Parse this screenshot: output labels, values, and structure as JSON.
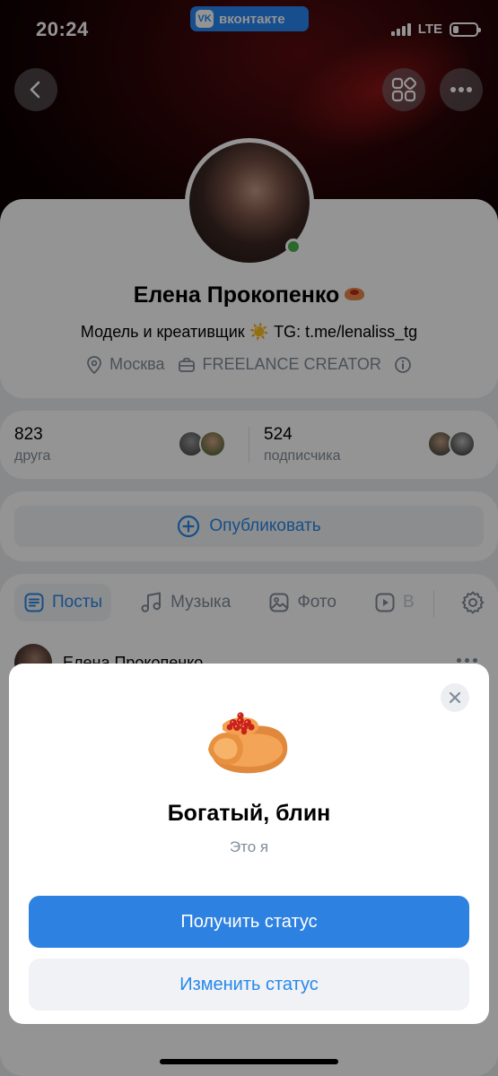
{
  "status_bar": {
    "time": "20:24",
    "app_badge": "вконтакте",
    "network": "LTE",
    "battery_level": 0.25
  },
  "header": {
    "back_icon": "chevron-left-icon",
    "services_icon": "grid-icon",
    "more_icon": "ellipsis-icon"
  },
  "profile": {
    "name": "Елена Прокопенко",
    "bio": "Модель и креативщик ☀️ TG: t.me/lenaliss_tg",
    "city": "Москва",
    "work": "FREELANCE CREATOR",
    "online": true
  },
  "stats": {
    "friends_count": "823",
    "friends_label": "друга",
    "followers_count": "524",
    "followers_label": "подписчика"
  },
  "publish": {
    "label": "Опубликовать"
  },
  "tabs": [
    {
      "label": "Посты",
      "active": true
    },
    {
      "label": "Музыка",
      "active": false
    },
    {
      "label": "Фото",
      "active": false
    },
    {
      "label": "В",
      "active": false
    }
  ],
  "post": {
    "author": "Елена Прокопенко"
  },
  "modal": {
    "title": "Богатый, блин",
    "subtitle": "Это я",
    "primary_button": "Получить статус",
    "secondary_button": "Изменить статус"
  },
  "colors": {
    "accent": "#2688eb",
    "primary_button": "#2d81e0",
    "secondary_text": "#818c99",
    "online": "#4bb34b"
  }
}
